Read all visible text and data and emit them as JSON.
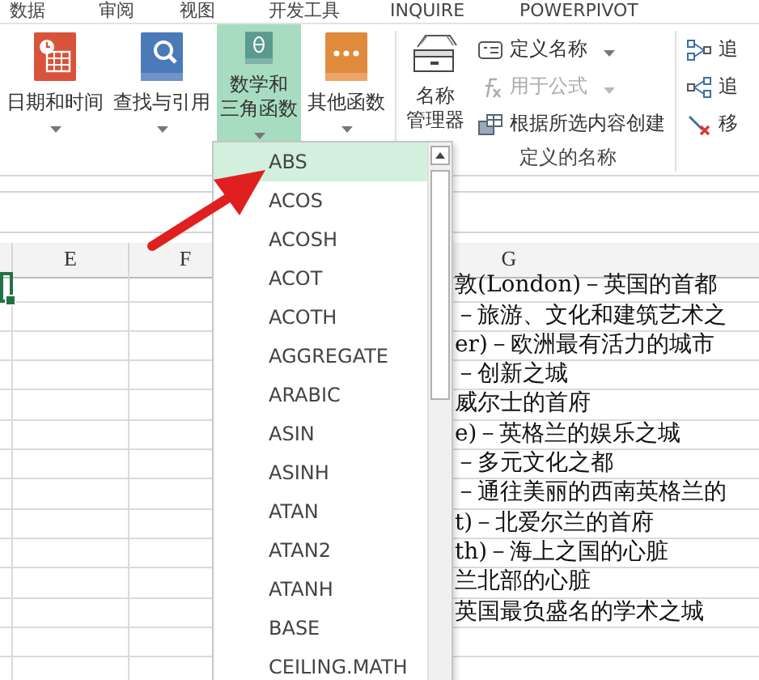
{
  "menu_tabs": [
    "数据",
    "审阅",
    "视图",
    "开发工具",
    "INQUIRE",
    "POWERPIVOT"
  ],
  "function_library": [
    {
      "label": "日期和时间",
      "kind": "calendar",
      "selected": false
    },
    {
      "label": "查找与引用",
      "kind": "lookup",
      "selected": false
    },
    {
      "label": "数学和三角函数",
      "kind": "math",
      "selected": true
    },
    {
      "label": "其他函数",
      "kind": "more",
      "selected": false
    }
  ],
  "defined_names": {
    "manager": "名称管理器",
    "commands": [
      {
        "label": "定义名称",
        "kind": "define",
        "dropdown": true,
        "disabled": false
      },
      {
        "label": "用于公式",
        "kind": "formula",
        "dropdown": true,
        "disabled": true
      },
      {
        "label": "根据所选内容创建",
        "kind": "create",
        "dropdown": false,
        "disabled": false
      }
    ],
    "group_label": "定义的名称"
  },
  "formula_auditing": [
    {
      "label": "追",
      "kind": "precedents"
    },
    {
      "label": "追",
      "kind": "dependents"
    },
    {
      "label": "移",
      "kind": "remove"
    }
  ],
  "sheet": {
    "columns": [
      "E",
      "F",
      "G"
    ],
    "g_cells": [
      "敦(London)－英国的首都",
      "－旅游、文化和建筑艺术之",
      "er)－欧洲最有活力的城市",
      "－创新之城",
      "威尔士的首府",
      "e)－英格兰的娱乐之城",
      "－多元文化之都",
      "－通往美丽的西南英格兰的",
      "t)－北爱尔兰的首府",
      "th)－海上之国的心脏",
      "兰北部的心脏",
      "英国最负盛名的学术之城"
    ]
  },
  "function_menu": {
    "items": [
      {
        "label": "ABS",
        "selected": true
      },
      {
        "label": "ACOS",
        "selected": false
      },
      {
        "label": "ACOSH",
        "selected": false
      },
      {
        "label": "ACOT",
        "selected": false
      },
      {
        "label": "ACOTH",
        "selected": false
      },
      {
        "label": "AGGREGATE",
        "selected": false
      },
      {
        "label": "ARABIC",
        "selected": false
      },
      {
        "label": "ASIN",
        "selected": false
      },
      {
        "label": "ASINH",
        "selected": false
      },
      {
        "label": "ATAN",
        "selected": false
      },
      {
        "label": "ATAN2",
        "selected": false
      },
      {
        "label": "ATANH",
        "selected": false
      },
      {
        "label": "BASE",
        "selected": false
      },
      {
        "label": "CEILING.MATH",
        "selected": false
      }
    ]
  }
}
